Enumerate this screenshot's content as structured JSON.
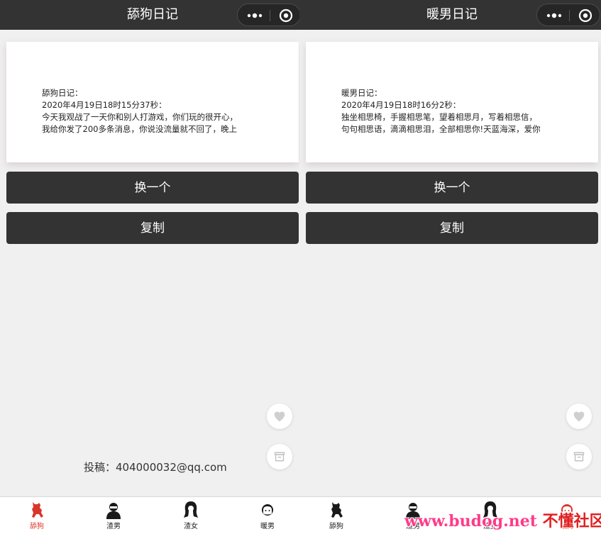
{
  "left": {
    "nav_title": "舔狗日记",
    "card": {
      "lines": [
        "舔狗日记：",
        "2020年4月19日18时15分37秒：",
        "今天我观战了一天你和别人打游戏，你们玩的很开心，",
        "我给你发了200多条消息，你说没流量就不回了，晚上"
      ]
    },
    "change_label": "换一个",
    "copy_label": "复制",
    "contribute_text": "投稿：404000032@qq.com"
  },
  "right": {
    "nav_title": "暖男日记",
    "card": {
      "lines": [
        "暖男日记：",
        "2020年4月19日18时16分2秒：",
        "独坐相思椅，手握相思笔，望着相思月，写着相思信，",
        "句句相思语，滴滴相思泪，全部相思你!天蓝海深，爱你"
      ]
    },
    "change_label": "换一个",
    "copy_label": "复制"
  },
  "tabs": [
    {
      "label": "舔狗",
      "icon": "dog-icon",
      "active": true
    },
    {
      "label": "渣男",
      "icon": "bad-man-icon",
      "active": false
    },
    {
      "label": "渣女",
      "icon": "bad-woman-icon",
      "active": false
    },
    {
      "label": "暖男",
      "icon": "warm-man-icon",
      "active": false
    },
    {
      "label": "舔狗",
      "icon": "dog-icon",
      "active": false
    },
    {
      "label": "渣男",
      "icon": "bad-man-icon",
      "active": false
    },
    {
      "label": "渣女",
      "icon": "bad-woman-icon",
      "active": false
    },
    {
      "label": "暖男",
      "icon": "warm-man-icon",
      "active": true
    }
  ],
  "watermark": {
    "url": "www.budog.net",
    "name": "不懂社区"
  },
  "colors": {
    "navbar": "#333333",
    "button": "#333333",
    "active_tab": "#d9362b",
    "background": "#f0f0f0"
  }
}
